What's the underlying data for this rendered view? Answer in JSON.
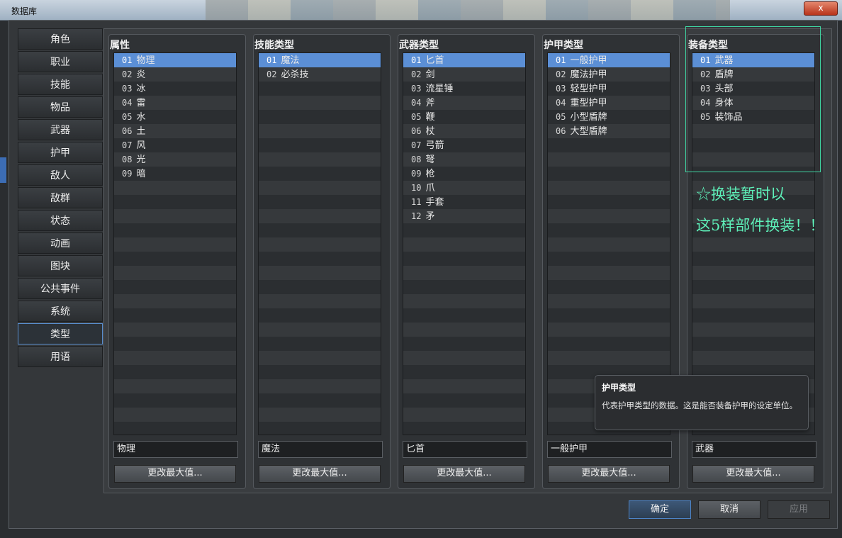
{
  "window": {
    "title": "数据库",
    "close_label": "x"
  },
  "nav": {
    "items": [
      "角色",
      "职业",
      "技能",
      "物品",
      "武器",
      "护甲",
      "敌人",
      "敌群",
      "状态",
      "动画",
      "图块",
      "公共事件",
      "系统",
      "类型",
      "用语"
    ],
    "selected_index": 13
  },
  "panels": [
    {
      "title": "属性",
      "rows": [
        [
          "01",
          "物理"
        ],
        [
          "02",
          "炎"
        ],
        [
          "03",
          "冰"
        ],
        [
          "04",
          "雷"
        ],
        [
          "05",
          "水"
        ],
        [
          "06",
          "土"
        ],
        [
          "07",
          "风"
        ],
        [
          "08",
          "光"
        ],
        [
          "09",
          "暗"
        ]
      ],
      "field": "物理",
      "button": "更改最大值..."
    },
    {
      "title": "技能类型",
      "rows": [
        [
          "01",
          "魔法"
        ],
        [
          "02",
          "必杀技"
        ]
      ],
      "field": "魔法",
      "button": "更改最大值..."
    },
    {
      "title": "武器类型",
      "rows": [
        [
          "01",
          "匕首"
        ],
        [
          "02",
          "剑"
        ],
        [
          "03",
          "流星锤"
        ],
        [
          "04",
          "斧"
        ],
        [
          "05",
          "鞭"
        ],
        [
          "06",
          "杖"
        ],
        [
          "07",
          "弓箭"
        ],
        [
          "08",
          "弩"
        ],
        [
          "09",
          "枪"
        ],
        [
          "10",
          "爪"
        ],
        [
          "11",
          "手套"
        ],
        [
          "12",
          "矛"
        ]
      ],
      "field": "匕首",
      "button": "更改最大值..."
    },
    {
      "title": "护甲类型",
      "rows": [
        [
          "01",
          "一般护甲"
        ],
        [
          "02",
          "魔法护甲"
        ],
        [
          "03",
          "轻型护甲"
        ],
        [
          "04",
          "重型护甲"
        ],
        [
          "05",
          "小型盾牌"
        ],
        [
          "06",
          "大型盾牌"
        ]
      ],
      "field": "一般护甲",
      "button": "更改最大值..."
    },
    {
      "title": "装备类型",
      "rows": [
        [
          "01",
          "武器"
        ],
        [
          "02",
          "盾牌"
        ],
        [
          "03",
          "头部"
        ],
        [
          "04",
          "身体"
        ],
        [
          "05",
          "装饰品"
        ]
      ],
      "field": "武器",
      "button": "更改最大值..."
    }
  ],
  "annotation": {
    "line1": "☆换装暂时以",
    "line2": "这5样部件换装！！",
    "color": "#5ef0b9"
  },
  "tooltip": {
    "title": "护甲类型",
    "body": "代表护甲类型的数据。这是能否装备护甲的设定单位。"
  },
  "buttons": {
    "ok": "确定",
    "cancel": "取消",
    "apply": "应用"
  },
  "colors": {
    "selection": "#5b8fd6",
    "highlight_border": "#3fd5a2"
  }
}
